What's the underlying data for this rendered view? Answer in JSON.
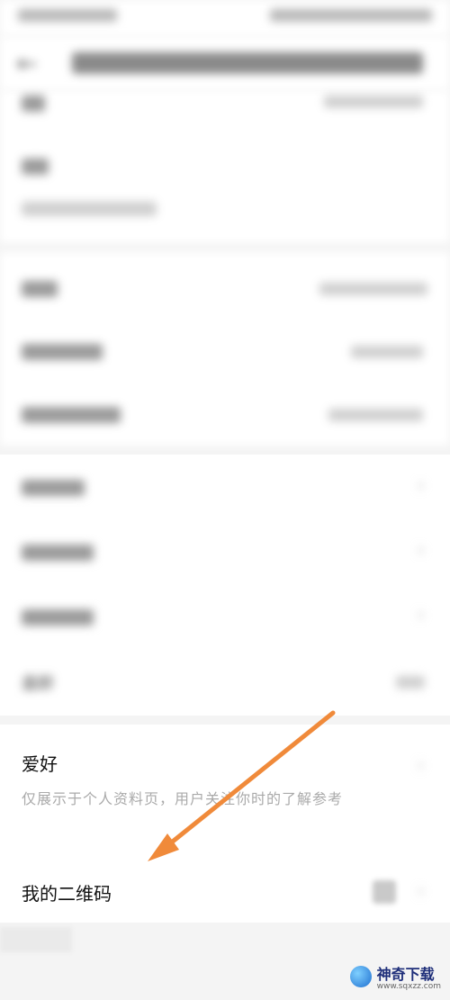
{
  "profile": {
    "hobby_label": "爱好",
    "hobby_description": "仅展示于个人资料页，用户关注你时的了解参考",
    "qr_label": "我的二维码",
    "age_label": "盒龄"
  },
  "watermark": {
    "brand": "神奇下载",
    "url": "www.sqxzz.com"
  },
  "colors": {
    "arrow": "#f08a3a",
    "background": "#f4f4f4",
    "card": "#ffffff"
  }
}
